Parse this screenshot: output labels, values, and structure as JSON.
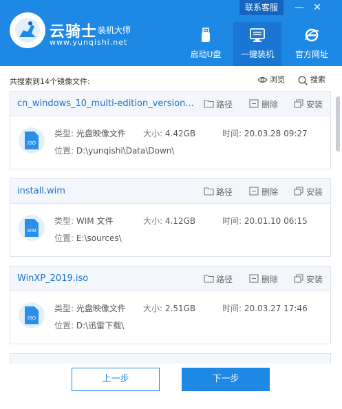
{
  "header": {
    "brand_name": "云骑士",
    "brand_sub": "装机大师",
    "brand_url": "www.yunqishi.net",
    "top_link": "联系客服",
    "nav": [
      {
        "label": "启动U盘",
        "icon": "usb-icon"
      },
      {
        "label": "一键装机",
        "icon": "monitor-icon"
      },
      {
        "label": "官方网址",
        "icon": "ie-icon"
      }
    ]
  },
  "toolbar": {
    "found_text": "共搜索到14个镜像文件:",
    "browse_label": "浏览",
    "search_label": "搜索"
  },
  "actions": {
    "path": "路径",
    "delete": "删除",
    "install": "安装"
  },
  "labels": {
    "type": "类型:",
    "size": "大小:",
    "time": "时间:",
    "location": "位置:"
  },
  "files": [
    {
      "name": "cn_windows_10_multi-edition_version...",
      "icon_text": "ISO",
      "type": "光盘映像文件",
      "size": "4.42GB",
      "time": "20.03.28 09:27",
      "location": "D:\\yunqishi\\Data\\Down\\"
    },
    {
      "name": "install.wim",
      "icon_text": "WIM",
      "type": "WIM 文件",
      "size": "4.12GB",
      "time": "20.01.10 06:15",
      "location": "E:\\sources\\"
    },
    {
      "name": "WinXP_2019.iso",
      "icon_text": "ISO",
      "type": "光盘映像文件",
      "size": "2.51GB",
      "time": "20.03.27 17:46",
      "location": "D:\\迅雷下载\\"
    }
  ],
  "footer": {
    "prev_label": "上一步",
    "next_label": "下一步"
  },
  "colors": {
    "accent": "#1e88e5",
    "title_link": "#1e73c9"
  }
}
